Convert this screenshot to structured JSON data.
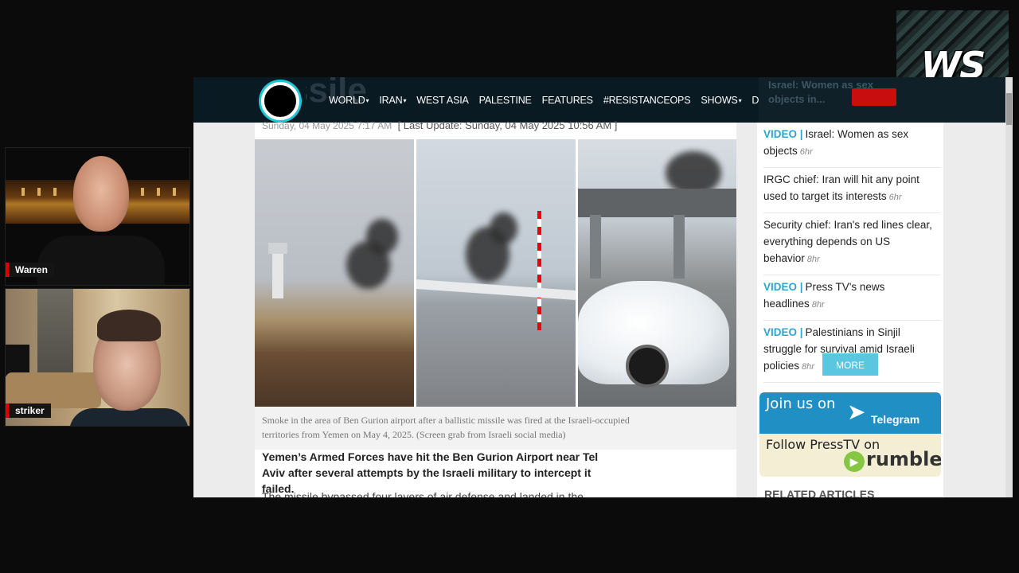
{
  "cams": [
    {
      "name": "Warren"
    },
    {
      "name": "striker"
    }
  ],
  "logo": {
    "text": "WS"
  },
  "site": {
    "ghost_title": "ssile",
    "nav": [
      {
        "label": "WORLD",
        "dropdown": true
      },
      {
        "label": "IRAN",
        "dropdown": true
      },
      {
        "label": "WEST ASIA",
        "dropdown": false
      },
      {
        "label": "PALESTINE",
        "dropdown": false
      },
      {
        "label": "FEATURES",
        "dropdown": false
      },
      {
        "label": "#RESISTANCEOPS",
        "dropdown": false
      },
      {
        "label": "SHOWS",
        "dropdown": true
      },
      {
        "label": "DOCUMENTARIES",
        "dropdown": false
      }
    ],
    "caret": "▾",
    "nav_right_ghost": [
      "Israel: Women as sex",
      "objects in..."
    ]
  },
  "article": {
    "date": "Sunday, 04 May 2025 7:17 AM",
    "last_update": "[ Last Update: Sunday, 04 May 2025 10:56 AM ]",
    "caption": "Smoke in the area of Ben Gurion airport after a ballistic missile was fired at the Israeli-occupied territories from Yemen on May 4, 2025. (Screen grab from Israeli social media)",
    "lede": "Yemen’s Armed Forces have hit the Ben Gurion Airport near Tel Aviv after several attempts by the Israeli military to intercept it failed.",
    "body_start": "The missile bypassed four layers of air defense and landed in the"
  },
  "sidebar": {
    "items": [
      {
        "tag": "VIDEO |",
        "text": "Israel: Women as sex objects",
        "ago": "6hr"
      },
      {
        "tag": "",
        "text": "IRGC chief: Iran will hit any point used to target its interests",
        "ago": "6hr"
      },
      {
        "tag": "",
        "text": "Security chief: Iran's red lines clear, everything depends on US behavior",
        "ago": "8hr"
      },
      {
        "tag": "VIDEO |",
        "text": "Press TV's news headlines",
        "ago": "8hr"
      },
      {
        "tag": "VIDEO |",
        "text": "Palestinians in Sinjil struggle for survival amid Israeli policies",
        "ago": "8hr"
      }
    ],
    "more": "MORE",
    "telegram": {
      "join": "Join us on",
      "name": "Telegram",
      "icon": "paper-plane-icon"
    },
    "rumble": {
      "follow": "Follow PressTV on",
      "name": "rumble",
      "icon": "play-icon"
    },
    "related": "RELATED ARTICLES"
  },
  "colors": {
    "accent": "#2aa6d0",
    "navbar": "#0a1a22",
    "red": "#c80e0e"
  }
}
